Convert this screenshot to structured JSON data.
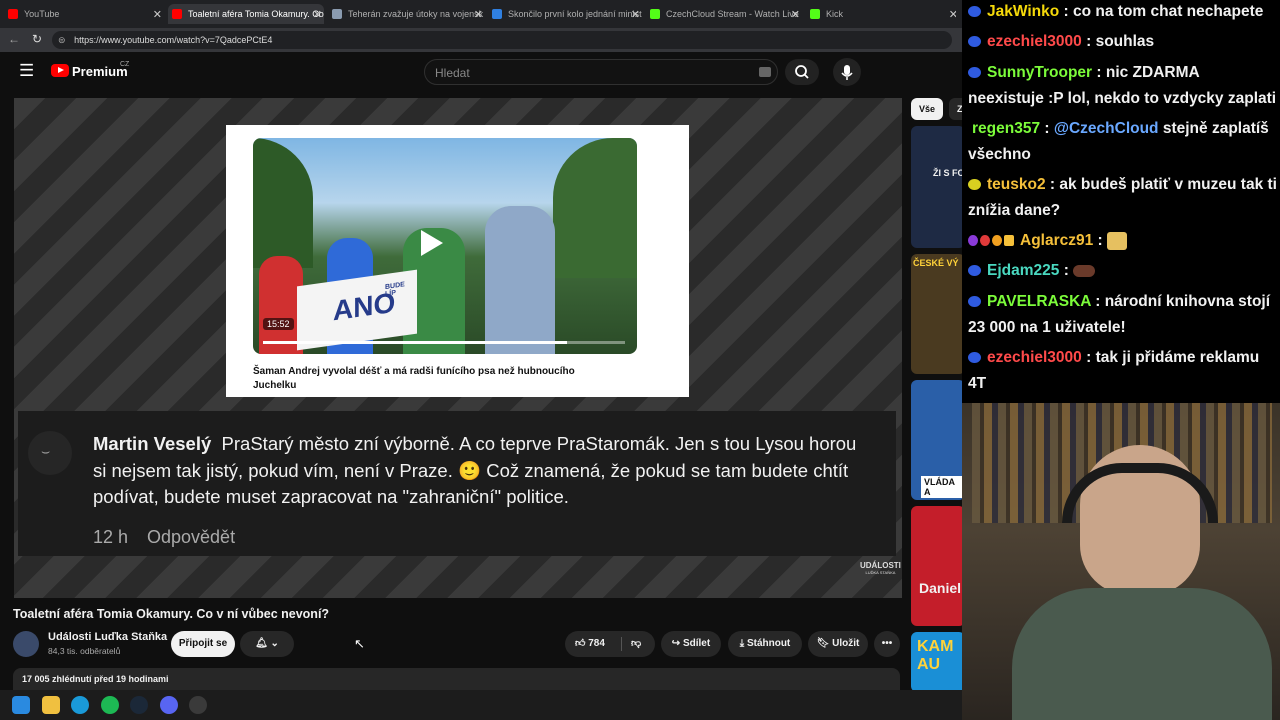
{
  "browser": {
    "tabs": [
      {
        "label": "YouTube",
        "color": "#ff0000"
      },
      {
        "label": "Toaletní aféra Tomia Okamury. Co",
        "color": "#ff0000"
      },
      {
        "label": "Teherán zvažuje útoky na vojensk",
        "color": "#8a9bb0"
      },
      {
        "label": "Skončilo první kolo jednání minist",
        "color": "#2f7fe0"
      },
      {
        "label": "CzechCloud Stream - Watch Live",
        "color": "#53fc18"
      },
      {
        "label": "Kick",
        "color": "#53fc18"
      }
    ],
    "url": "https://www.youtube.com/watch?v=7QadcePCtE4"
  },
  "yt": {
    "logo": "Premium",
    "region": "CZ",
    "search_placeholder": "Hledat",
    "chips": [
      "Vše",
      "Z"
    ]
  },
  "video": {
    "card_duration": "15:52",
    "card_title": "Šaman Andrej vyvolal déšť a má radši funícího psa než hubnoucího Juchelku",
    "sign": "ANO",
    "sign_sub": "BUDE LÍP",
    "watermark": "UDÁLOSTI",
    "watermark_sub": "LUĎKA STAŇKA",
    "comment": {
      "author": "Martin Veselý",
      "text_pre": "PraStarý město zní výborně. A co teprve PraStaromák. Jen s tou Lysou horou si nejsem tak jistý, pokud vím, není v Praze.",
      "emoji": "🙂",
      "text_post": "Což znamená, že pokud se tam budete chtít podívat, budete muset zapracovat na \"zahraniční\" politice.",
      "time": "12 h",
      "reply": "Odpovědět"
    }
  },
  "meta": {
    "title": "Toaletní aféra Tomia Okamury. Co v ní vůbec nevoní?",
    "channel": "Události Luďka Staňka",
    "subs": "84,3 tis. odběratelů",
    "join": "Připojit se",
    "likes": "784",
    "share": "Sdílet",
    "download": "Stáhnout",
    "save": "Uložit",
    "views": "17 005 zhlédnutí  před 19 hodinami"
  },
  "recommended": [
    {
      "text": "ŽI S FO",
      "bg": "#1e2a44"
    },
    {
      "text": "ČESKÉ VÝ",
      "bg": "#4a3a20"
    },
    {
      "text": "VLÁDA A",
      "bg": "#2a5fa8"
    },
    {
      "text": "Daniel",
      "bg": "#c41e2a"
    },
    {
      "text": "KAM AU",
      "bg": "#1a8fd6"
    }
  ],
  "chat": [
    {
      "user": "JakWinko",
      "color": "#f5d90a",
      "msg": "co na tom chat nechapete",
      "badge": "#2f5be0"
    },
    {
      "user": "ezechiel3000",
      "color": "#ff4a4a",
      "msg": "souhlas",
      "badge": "#2f5be0"
    },
    {
      "user": "SunnyTrooper",
      "color": "#7cfc3a",
      "msg": "nic ZDARMA neexistuje :P lol, nekdo to vzdycky zaplati",
      "badge": "#2f5be0"
    },
    {
      "user": "regen357",
      "color": "#7cfc3a",
      "msg_mention": "@CzechCloud",
      "msg": "stejně zaplatíš všechno",
      "badge": ""
    },
    {
      "user": "teusko2",
      "color": "#f5c03a",
      "msg": "ak budeš platiť v muzeu tak ti znížia dane?",
      "badge": "#d8d020"
    },
    {
      "user": "Aglarcz91",
      "color": "#f5c03a",
      "msg": "",
      "badge": "#8a3ad8"
    },
    {
      "user": "Ejdam225",
      "color": "#4ad8c0",
      "msg": "",
      "badge": "#2f5be0"
    },
    {
      "user": "PAVELRASKA",
      "color": "#7cfc3a",
      "msg": "národní knihovna stojí 23 000 na 1 uživatele!",
      "badge": "#2f5be0"
    },
    {
      "user": "ezechiel3000",
      "color": "#ff4a4a",
      "msg": "tak ji přidáme reklamu 4T",
      "badge": "#2f5be0"
    }
  ]
}
